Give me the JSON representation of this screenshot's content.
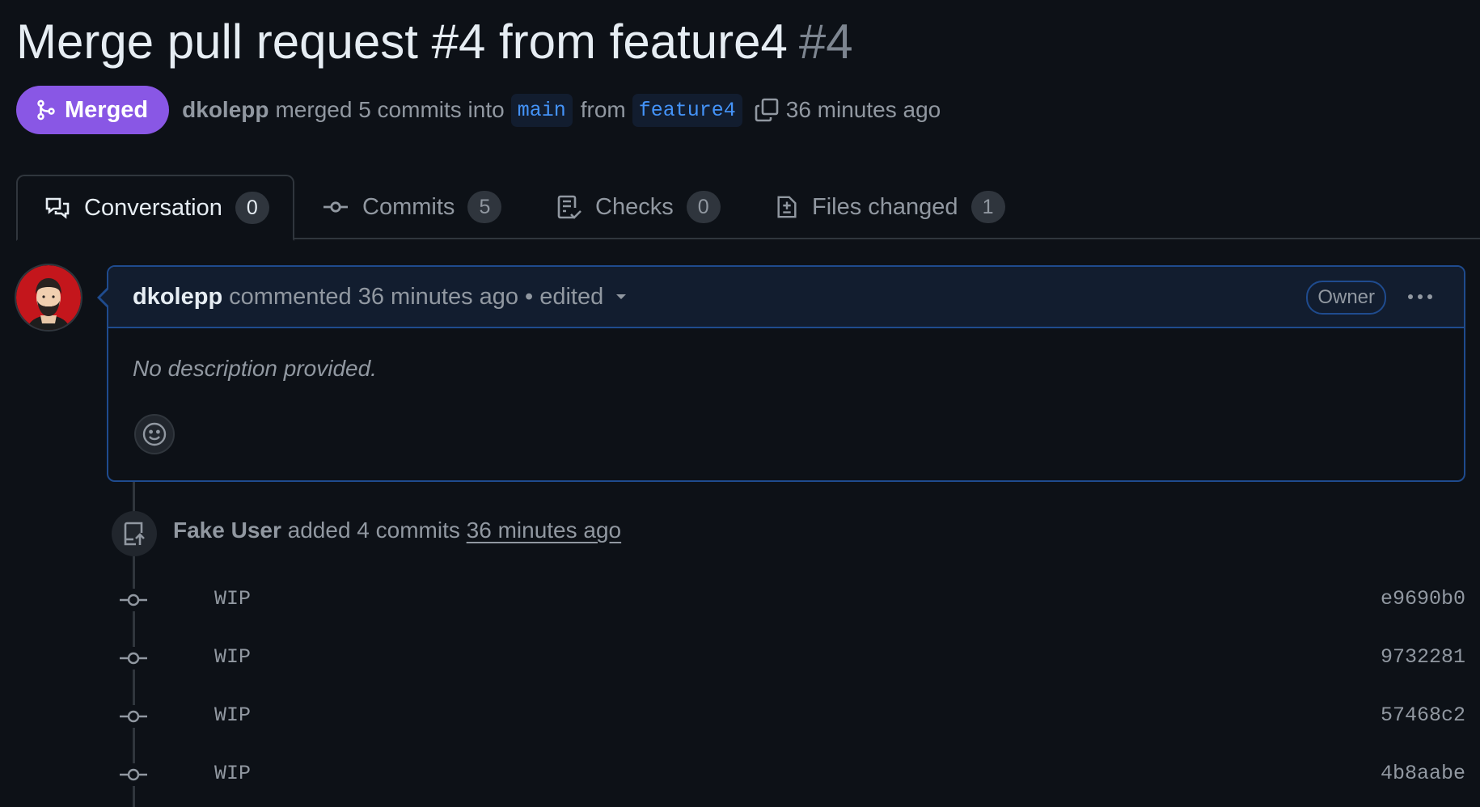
{
  "pr": {
    "title": "Merge pull request #4 from feature4",
    "number": "#4",
    "state_label": "Merged",
    "author": "dkolepp",
    "action_text": "merged 5 commits into",
    "base_branch": "main",
    "from_text": "from",
    "head_branch": "feature4",
    "time": "36 minutes ago"
  },
  "tabs": [
    {
      "label": "Conversation",
      "count": "0",
      "icon": "comment-discussion-icon"
    },
    {
      "label": "Commits",
      "count": "5",
      "icon": "git-commit-icon"
    },
    {
      "label": "Checks",
      "count": "0",
      "icon": "checklist-icon"
    },
    {
      "label": "Files changed",
      "count": "1",
      "icon": "file-diff-icon"
    }
  ],
  "comment": {
    "author": "dkolepp",
    "meta": "commented 36 minutes ago",
    "separator": "•",
    "edited": "edited",
    "role_badge": "Owner",
    "body": "No description provided."
  },
  "event": {
    "author": "Fake User",
    "text": "added 4 commits",
    "time": "36 minutes ago"
  },
  "commits": [
    {
      "message": "WIP",
      "sha": "e9690b0"
    },
    {
      "message": "WIP",
      "sha": "9732281"
    },
    {
      "message": "WIP",
      "sha": "57468c2"
    },
    {
      "message": "WIP",
      "sha": "4b8aabe"
    }
  ],
  "colors": {
    "background": "#0d1117",
    "merged": "#8957e5",
    "accent_border": "#1f4b8e",
    "link": "#4493f8",
    "muted": "#9198a1"
  }
}
